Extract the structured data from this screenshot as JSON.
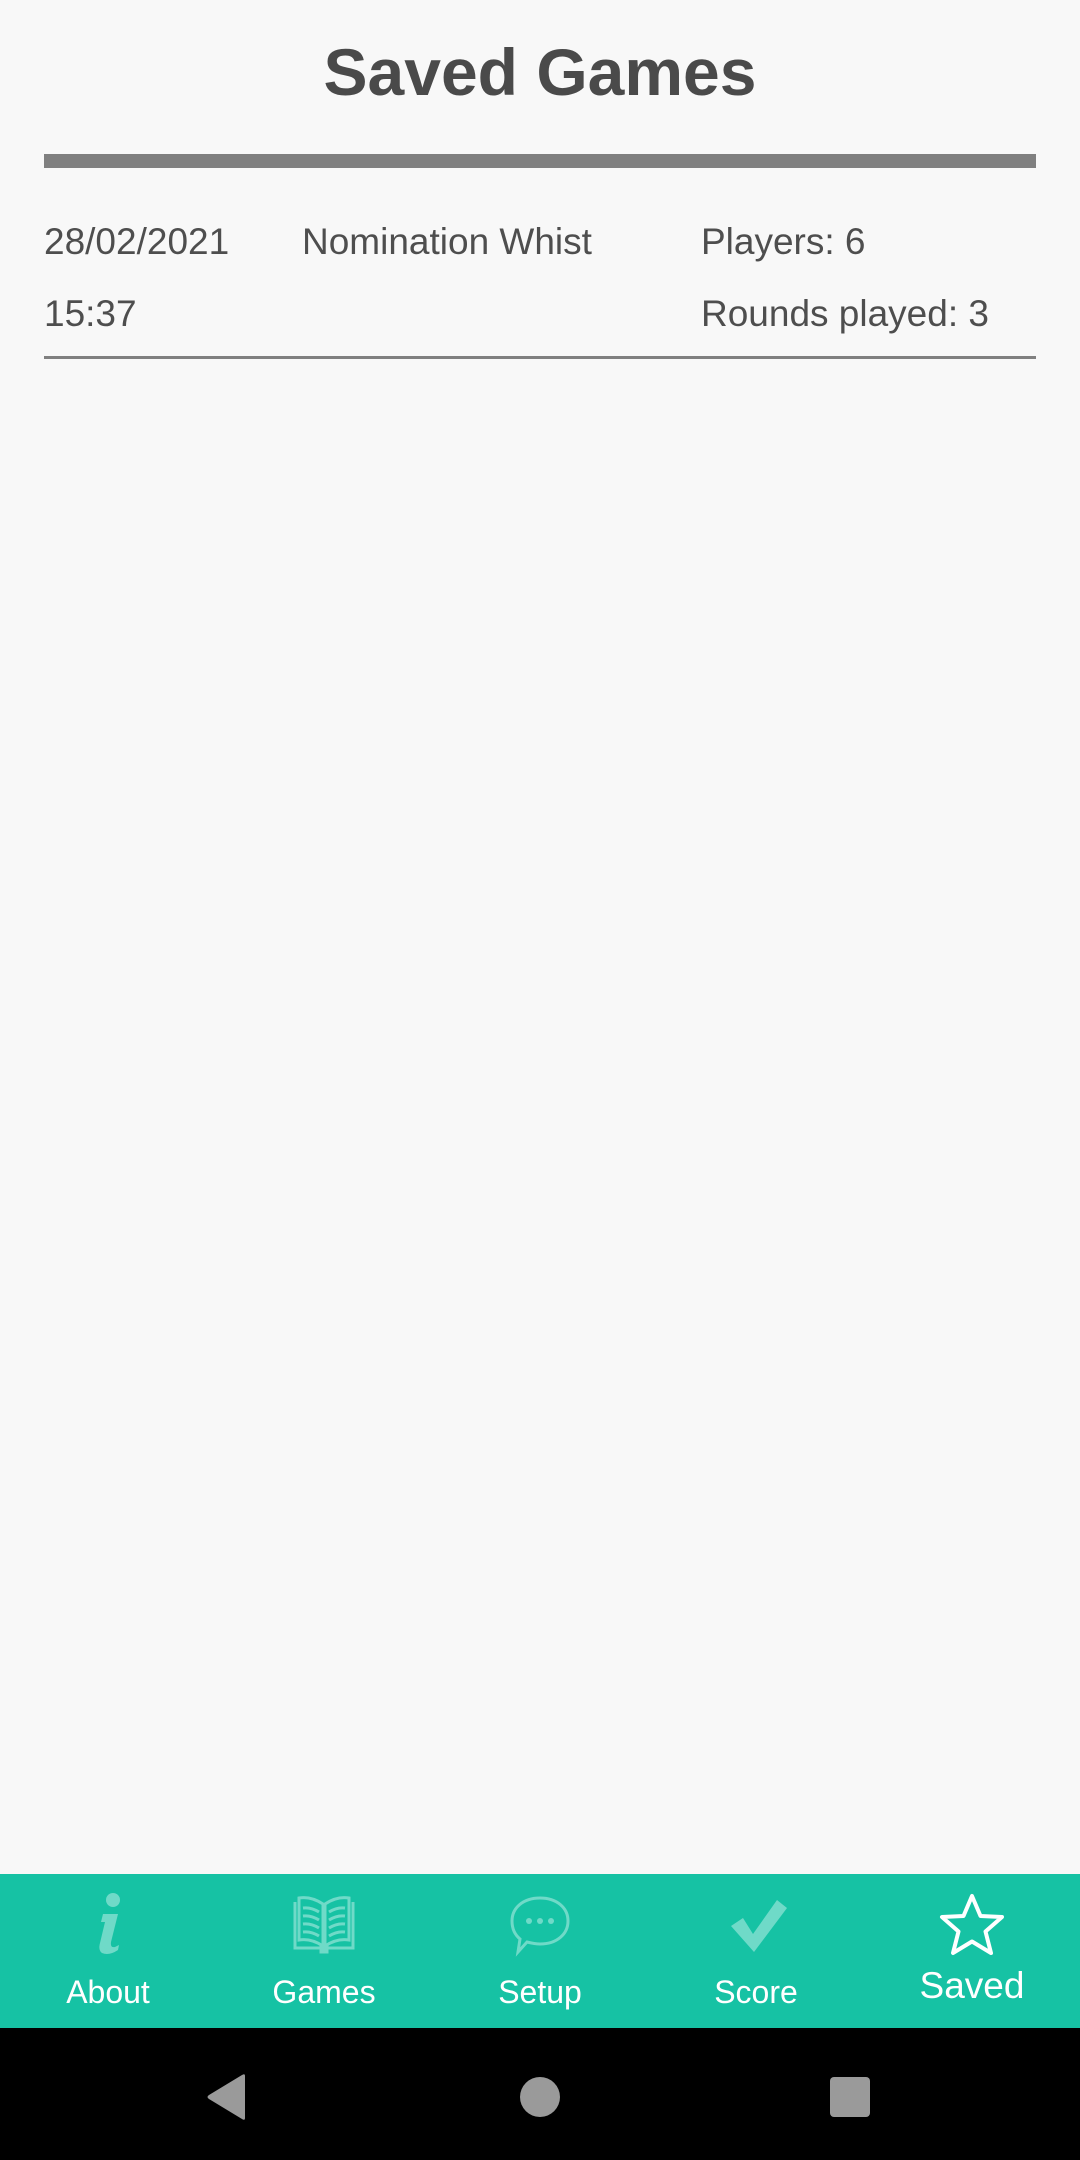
{
  "page": {
    "title": "Saved Games"
  },
  "saved_games": [
    {
      "date": "28/02/2021",
      "time": "15:37",
      "game": "Nomination Whist",
      "players": "Players: 6",
      "rounds": "Rounds played: 3"
    }
  ],
  "bottom_nav": {
    "active": "Saved",
    "items": [
      {
        "label": "About",
        "icon": "info-icon"
      },
      {
        "label": "Games",
        "icon": "book-icon"
      },
      {
        "label": "Setup",
        "icon": "chat-bubble-icon"
      },
      {
        "label": "Score",
        "icon": "checkmark-icon"
      },
      {
        "label": "Saved",
        "icon": "star-icon"
      }
    ]
  },
  "system_nav": {
    "buttons": [
      "back",
      "home",
      "recents"
    ]
  },
  "colors": {
    "accent": "#16c2a4",
    "inactive_icon": "#6fdac8",
    "text": "#4a4a4a",
    "divider": "#808080",
    "background": "#f8f8f8"
  }
}
